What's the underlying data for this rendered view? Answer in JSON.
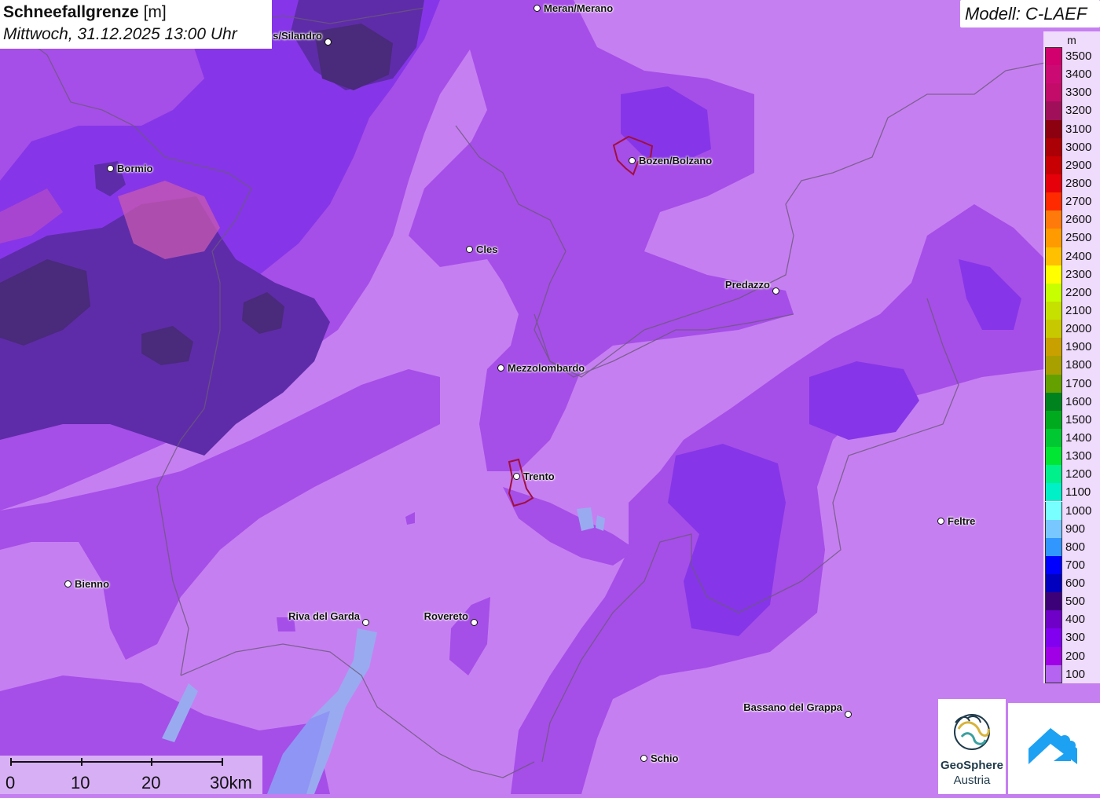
{
  "header": {
    "title": "Schneefallgrenze",
    "unit": "[m]",
    "datetime": "Mittwoch, 31.12.2025 13:00 Uhr"
  },
  "model": "Modell: C-LAEF",
  "legend": {
    "unit": "m",
    "levels": [
      {
        "label": "3500",
        "color": "#d2006e"
      },
      {
        "label": "3400",
        "color": "#cc0a74"
      },
      {
        "label": "3300",
        "color": "#c30c6a"
      },
      {
        "label": "3200",
        "color": "#a0105a"
      },
      {
        "label": "3100",
        "color": "#8c0010"
      },
      {
        "label": "3000",
        "color": "#aa0006"
      },
      {
        "label": "2900",
        "color": "#c80004"
      },
      {
        "label": "2800",
        "color": "#e6000a"
      },
      {
        "label": "2700",
        "color": "#ff2a00"
      },
      {
        "label": "2600",
        "color": "#ff7a0a"
      },
      {
        "label": "2500",
        "color": "#ff9a00"
      },
      {
        "label": "2400",
        "color": "#ffc000"
      },
      {
        "label": "2300",
        "color": "#ffff00"
      },
      {
        "label": "2200",
        "color": "#c8ff00"
      },
      {
        "label": "2100",
        "color": "#c6e000"
      },
      {
        "label": "2000",
        "color": "#c8c800"
      },
      {
        "label": "1900",
        "color": "#c8a000"
      },
      {
        "label": "1800",
        "color": "#a8a000"
      },
      {
        "label": "1700",
        "color": "#64a000"
      },
      {
        "label": "1600",
        "color": "#00821e"
      },
      {
        "label": "1500",
        "color": "#00aa1e"
      },
      {
        "label": "1400",
        "color": "#00c832"
      },
      {
        "label": "1300",
        "color": "#00e632"
      },
      {
        "label": "1200",
        "color": "#00f08c"
      },
      {
        "label": "1100",
        "color": "#00f0c8"
      },
      {
        "label": "1000",
        "color": "#78ffff"
      },
      {
        "label": "900",
        "color": "#78c8ff"
      },
      {
        "label": "800",
        "color": "#3296ff"
      },
      {
        "label": "700",
        "color": "#0000ff"
      },
      {
        "label": "600",
        "color": "#0000be"
      },
      {
        "label": "500",
        "color": "#3c0078"
      },
      {
        "label": "400",
        "color": "#6e00c8"
      },
      {
        "label": "300",
        "color": "#8200f0"
      },
      {
        "label": "200",
        "color": "#a000e6"
      },
      {
        "label": "100",
        "color": "#b464f0"
      }
    ]
  },
  "cities": [
    {
      "name": "Meran/Merano"
    },
    {
      "name": "s/Silandro"
    },
    {
      "name": "Bormio"
    },
    {
      "name": "Bozen/Bolzano"
    },
    {
      "name": "Cles"
    },
    {
      "name": "Predazzo"
    },
    {
      "name": "Mezzolombardo"
    },
    {
      "name": "Trento"
    },
    {
      "name": "Feltre"
    },
    {
      "name": "Bienno"
    },
    {
      "name": "Riva del Garda"
    },
    {
      "name": "Rovereto"
    },
    {
      "name": "Bassano del Grappa"
    },
    {
      "name": "Schio"
    }
  ],
  "scalebar": {
    "labels": [
      "0",
      "10",
      "20",
      "30km"
    ]
  },
  "logos": {
    "geosphere_line1": "GeoSphere",
    "geosphere_line2": "Austria"
  }
}
